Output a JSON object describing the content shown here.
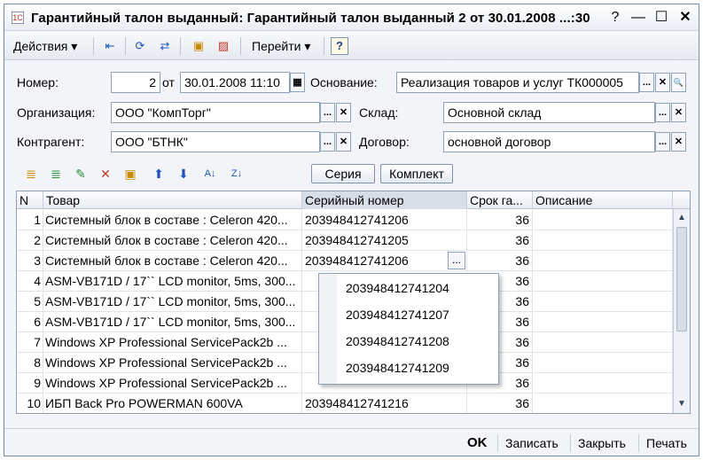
{
  "window": {
    "title": "Гарантийный талон выданный: Гарантийный талон выданный 2 от 30.01.2008 ...:30",
    "help_glyph": "?",
    "min_glyph": "—",
    "max_glyph": "☐",
    "close_glyph": "✕"
  },
  "toolbar": {
    "actions_label": "Действия ▾",
    "goto_label": "Перейти ▾",
    "help_label": "?"
  },
  "form": {
    "number_label": "Номер:",
    "number_value": "2",
    "from_label": "от",
    "date_value": "30.01.2008 11:10",
    "basis_label": "Основание:",
    "basis_value": "Реализация товаров и услуг ТК000005",
    "org_label": "Организация:",
    "org_value": "ООО \"КомпТорг\"",
    "warehouse_label": "Склад:",
    "warehouse_value": "Основной склад",
    "contractor_label": "Контрагент:",
    "contractor_value": "ООО \"БТНК\"",
    "contract_label": "Договор:",
    "contract_value": "основной договор",
    "select_glyph": "...",
    "clear_glyph": "✕",
    "search_glyph": "🔍",
    "calendar_glyph": "▦"
  },
  "table_toolbar": {
    "series_button": "Серия",
    "kit_button": "Комплект"
  },
  "table": {
    "columns": [
      "N",
      "Товар",
      "Серийный номер",
      "Срок га...",
      "Описание"
    ],
    "rows": [
      {
        "n": "1",
        "item": "Системный блок в составе : Celeron 420...",
        "serial": "203948412741206",
        "term": "36",
        "desc": ""
      },
      {
        "n": "2",
        "item": "Системный блок в составе : Celeron 420...",
        "serial": "203948412741205",
        "term": "36",
        "desc": ""
      },
      {
        "n": "3",
        "item": "Системный блок в составе : Celeron 420...",
        "serial": "203948412741206",
        "term": "36",
        "desc": ""
      },
      {
        "n": "4",
        "item": "ASM-VB171D / 17`` LCD monitor, 5ms, 300...",
        "serial": "",
        "term": "36",
        "desc": ""
      },
      {
        "n": "5",
        "item": "ASM-VB171D / 17`` LCD monitor, 5ms, 300...",
        "serial": "",
        "term": "36",
        "desc": ""
      },
      {
        "n": "6",
        "item": "ASM-VB171D / 17`` LCD monitor, 5ms, 300...",
        "serial": "",
        "term": "36",
        "desc": ""
      },
      {
        "n": "7",
        "item": "Windows XP Professional ServicePack2b ...",
        "serial": "",
        "term": "36",
        "desc": ""
      },
      {
        "n": "8",
        "item": "Windows XP Professional ServicePack2b ...",
        "serial": "",
        "term": "36",
        "desc": ""
      },
      {
        "n": "9",
        "item": "Windows XP Professional ServicePack2b ...",
        "serial": "",
        "term": "36",
        "desc": ""
      },
      {
        "n": "10",
        "item": "ИБП Back Pro POWERMAN 600VA",
        "serial": "203948412741216",
        "term": "36",
        "desc": ""
      }
    ],
    "cell_button_glyph": "..."
  },
  "dropdown": {
    "options": [
      "203948412741204",
      "203948412741207",
      "203948412741208",
      "203948412741209"
    ]
  },
  "bottom": {
    "ok": "OK",
    "save": "Записать",
    "close": "Закрыть",
    "print": "Печать"
  }
}
